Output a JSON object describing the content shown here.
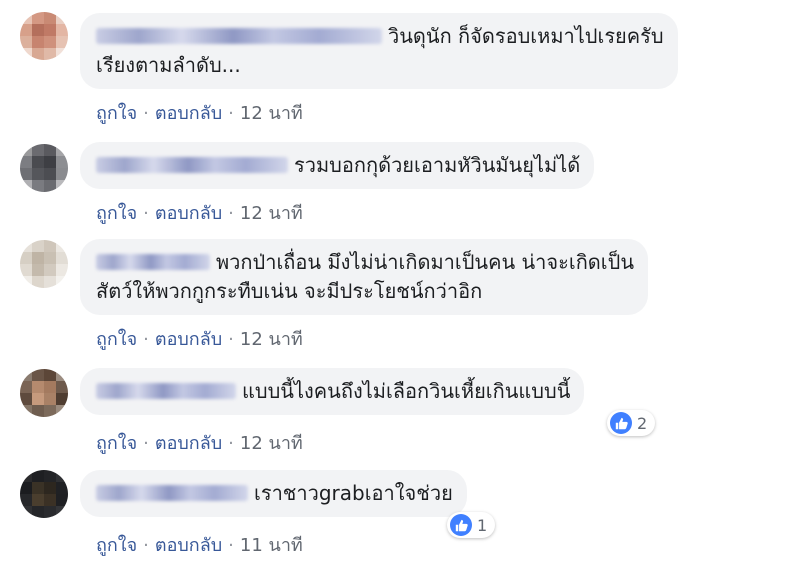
{
  "labels": {
    "like": "ถูกใจ",
    "reply": "ตอบกลับ",
    "separator": "·"
  },
  "comments": [
    {
      "text_lines": [
        "วินดุนัก ก็จัดรอบเหมาไปเรยครับ",
        "เรียงตามลำดับ..."
      ],
      "time": "12 นาที",
      "author_blurred": true
    },
    {
      "text_lines": [
        "รวมบอกกุด้วยเอามหัวินมันยุไม่ได้"
      ],
      "time": "12 นาที",
      "author_blurred": true
    },
    {
      "text_lines": [
        "พวกป่าเถื่อน มึงไม่น่าเกิดมาเป็นคน น่าจะเกิดเป็น",
        "สัตว์ให้พวกกูกระทืบเน่น จะมีประโยชน์กว่าอิก"
      ],
      "time": "12 นาที",
      "author_blurred": true
    },
    {
      "text_lines": [
        "แบบนี้ไงคนถึงไม่เลือกวินเหี้ยเกินแบบนี้"
      ],
      "time": "12 นาที",
      "author_blurred": true,
      "reaction": {
        "icon": "thumbs-up-icon",
        "count": "2"
      }
    },
    {
      "text_lines": [
        "เราชาวgrabเอาใจช่วย"
      ],
      "time": "11 นาที",
      "author_blurred": true,
      "reaction": {
        "icon": "thumbs-up-icon",
        "count": "1"
      }
    }
  ],
  "colors": {
    "bubble_bg": "#f2f3f5",
    "link": "#385898",
    "like_blue": "#4080ff"
  }
}
